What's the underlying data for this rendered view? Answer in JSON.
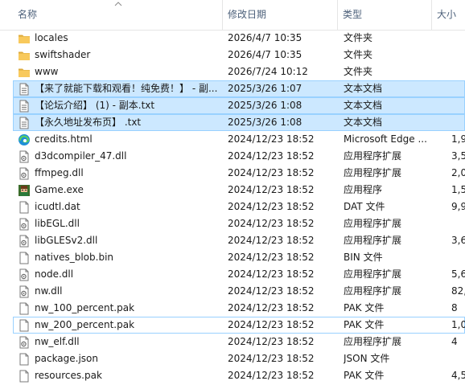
{
  "columns": {
    "name": "名称",
    "date": "修改日期",
    "type": "类型",
    "size": "大小"
  },
  "files": [
    {
      "name": "locales",
      "date": "2026/4/7 10:35",
      "type": "文件夹",
      "size": "",
      "icon": "folder-icon"
    },
    {
      "name": "swiftshader",
      "date": "2026/4/7 10:35",
      "type": "文件夹",
      "size": "",
      "icon": "folder-icon"
    },
    {
      "name": "www",
      "date": "2026/7/24 10:12",
      "type": "文件夹",
      "size": "",
      "icon": "folder-icon"
    },
    {
      "name": "【来了就能下载和观看！纯免费！】 - 副...",
      "date": "2025/3/26 1:07",
      "type": "文本文档",
      "size": "",
      "icon": "text-file-icon",
      "selected": true
    },
    {
      "name": "【论坛介绍】 (1) - 副本.txt",
      "date": "2025/3/26 1:08",
      "type": "文本文档",
      "size": "",
      "icon": "text-file-icon",
      "selected": true
    },
    {
      "name": "【永久地址发布页】 .txt",
      "date": "2025/3/26 1:08",
      "type": "文本文档",
      "size": "",
      "icon": "text-file-icon",
      "selected": true
    },
    {
      "name": "credits.html",
      "date": "2024/12/23 18:52",
      "type": "Microsoft Edge ...",
      "size": "1,9",
      "icon": "edge-icon"
    },
    {
      "name": "d3dcompiler_47.dll",
      "date": "2024/12/23 18:52",
      "type": "应用程序扩展",
      "size": "3,5",
      "icon": "dll-file-icon"
    },
    {
      "name": "ffmpeg.dll",
      "date": "2024/12/23 18:52",
      "type": "应用程序扩展",
      "size": "2,0",
      "icon": "dll-file-icon"
    },
    {
      "name": "Game.exe",
      "date": "2024/12/23 18:52",
      "type": "应用程序",
      "size": "1,5",
      "icon": "game-exe-icon"
    },
    {
      "name": "icudtl.dat",
      "date": "2024/12/23 18:52",
      "type": "DAT 文件",
      "size": "9,9",
      "icon": "blank-file-icon"
    },
    {
      "name": "libEGL.dll",
      "date": "2024/12/23 18:52",
      "type": "应用程序扩展",
      "size": "",
      "icon": "dll-file-icon"
    },
    {
      "name": "libGLESv2.dll",
      "date": "2024/12/23 18:52",
      "type": "应用程序扩展",
      "size": "3,6",
      "icon": "dll-file-icon"
    },
    {
      "name": "natives_blob.bin",
      "date": "2024/12/23 18:52",
      "type": "BIN 文件",
      "size": "",
      "icon": "blank-file-icon"
    },
    {
      "name": "node.dll",
      "date": "2024/12/23 18:52",
      "type": "应用程序扩展",
      "size": "5,6",
      "icon": "dll-file-icon"
    },
    {
      "name": "nw.dll",
      "date": "2024/12/23 18:52",
      "type": "应用程序扩展",
      "size": "82,4",
      "icon": "dll-file-icon"
    },
    {
      "name": "nw_100_percent.pak",
      "date": "2024/12/23 18:52",
      "type": "PAK 文件",
      "size": "8",
      "icon": "blank-file-icon"
    },
    {
      "name": "nw_200_percent.pak",
      "date": "2024/12/23 18:52",
      "type": "PAK 文件",
      "size": "1,0",
      "icon": "blank-file-icon",
      "focused": true
    },
    {
      "name": "nw_elf.dll",
      "date": "2024/12/23 18:52",
      "type": "应用程序扩展",
      "size": "4",
      "icon": "dll-file-icon"
    },
    {
      "name": "package.json",
      "date": "2024/12/23 18:52",
      "type": "JSON 文件",
      "size": "",
      "icon": "blank-file-icon"
    },
    {
      "name": "resources.pak",
      "date": "2024/12/23 18:52",
      "type": "PAK 文件",
      "size": "4,5",
      "icon": "blank-file-icon"
    }
  ],
  "colors": {
    "selection": "#cce8ff",
    "selection_border": "#99d1ff",
    "header_text": "#4c607a",
    "folder": "#f8c95c"
  }
}
